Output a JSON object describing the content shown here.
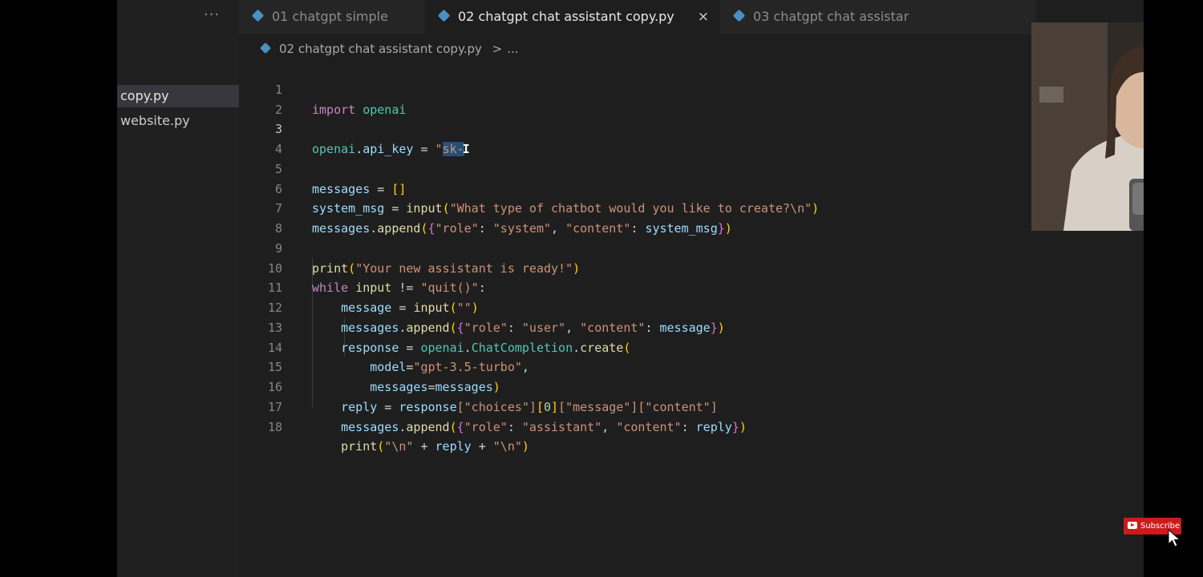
{
  "sidebar": {
    "more_label": "···",
    "files": [
      {
        "label": "copy.py",
        "active": true
      },
      {
        "label": "website.py",
        "active": false
      }
    ]
  },
  "tabs": [
    {
      "label": "01 chatgpt simple",
      "active": false
    },
    {
      "label": "02 chatgpt chat assistant copy.py",
      "active": true
    },
    {
      "label": "03 chatgpt chat assistar",
      "active": false
    }
  ],
  "tab_close_icon": "×",
  "breadcrumb": {
    "file": "02 chatgpt chat assistant copy.py",
    "separator": ">",
    "ellipsis": "..."
  },
  "editor": {
    "current_line": 3,
    "line_numbers": [
      "1",
      "2",
      "3",
      "4",
      "5",
      "6",
      "7",
      "8",
      "9",
      "10",
      "11",
      "12",
      "13",
      "14",
      "15",
      "16",
      "17",
      "18"
    ],
    "code": {
      "l1": {
        "import": "import",
        "module": "openai"
      },
      "l3": {
        "obj": "openai",
        "dot": ".",
        "attr": "api_key",
        "eq": " = ",
        "q": "\"",
        "sel": "sk-"
      },
      "l5": {
        "var": "messages",
        "eq": " = ",
        "br": "[]"
      },
      "l6": {
        "var": "system_msg",
        "eq": " = ",
        "fn": "input",
        "open": "(",
        "str": "\"What type of chatbot would you like to create?\\n\"",
        "close": ")"
      },
      "l7": {
        "obj": "messages",
        "dot": ".",
        "fn": "append",
        "open": "(",
        "brace_open": "{",
        "k1": "\"role\"",
        "c1": ": ",
        "v1": "\"system\"",
        "comma": ", ",
        "k2": "\"content\"",
        "c2": ": ",
        "v2": "system_msg",
        "brace_close": "}",
        "close": ")"
      },
      "l9": {
        "fn": "print",
        "open": "(",
        "str": "\"Your new assistant is ready!\"",
        "close": ")"
      },
      "l10": {
        "kw": "while",
        "sp": " ",
        "fn": "input",
        "op": " != ",
        "str": "\"quit()\"",
        "colon": ":"
      },
      "l11": {
        "var": "message",
        "eq": " = ",
        "fn": "input",
        "open": "(",
        "str": "\"\"",
        "close": ")"
      },
      "l12": {
        "obj": "messages",
        "dot": ".",
        "fn": "append",
        "open": "(",
        "brace_open": "{",
        "k1": "\"role\"",
        "c1": ": ",
        "v1": "\"user\"",
        "comma": ", ",
        "k2": "\"content\"",
        "c2": ": ",
        "v2": "message",
        "brace_close": "}",
        "close": ")"
      },
      "l13": {
        "var": "response",
        "eq": " = ",
        "obj": "openai",
        "dot": ".",
        "cls": "ChatCompletion",
        "dot2": ".",
        "fn": "create",
        "open": "("
      },
      "l14": {
        "param": "model",
        "eq": "=",
        "str": "\"gpt-3.5-turbo\"",
        "comma": ","
      },
      "l15": {
        "param": "messages",
        "eq": "=",
        "var": "messages",
        "close": ")"
      },
      "l16": {
        "var": "reply",
        "eq": " = ",
        "obj": "response",
        "i1": "[\"choices\"]",
        "i2o": "[",
        "i2": "0",
        "i2c": "]",
        "i3": "[\"message\"]",
        "i4": "[\"content\"]"
      },
      "l17": {
        "obj": "messages",
        "dot": ".",
        "fn": "append",
        "open": "(",
        "brace_open": "{",
        "k1": "\"role\"",
        "c1": ": ",
        "v1": "\"assistant\"",
        "comma": ", ",
        "k2": "\"content\"",
        "c2": ": ",
        "v2": "reply",
        "brace_close": "}",
        "close": ")"
      },
      "l18": {
        "fn": "print",
        "open": "(",
        "s1": "\"\\n\"",
        "plus1": " + ",
        "var": "reply",
        "plus2": " + ",
        "s2": "\"\\n\"",
        "close": ")"
      }
    }
  },
  "overlay": {
    "subscribe_label": "Subscribe",
    "subscribe_color": "#cc1b1b"
  },
  "icons": {
    "python_file": "python-file-icon",
    "mouse_pointer": "mouse-pointer-icon",
    "text_cursor": "text-cursor-icon"
  }
}
